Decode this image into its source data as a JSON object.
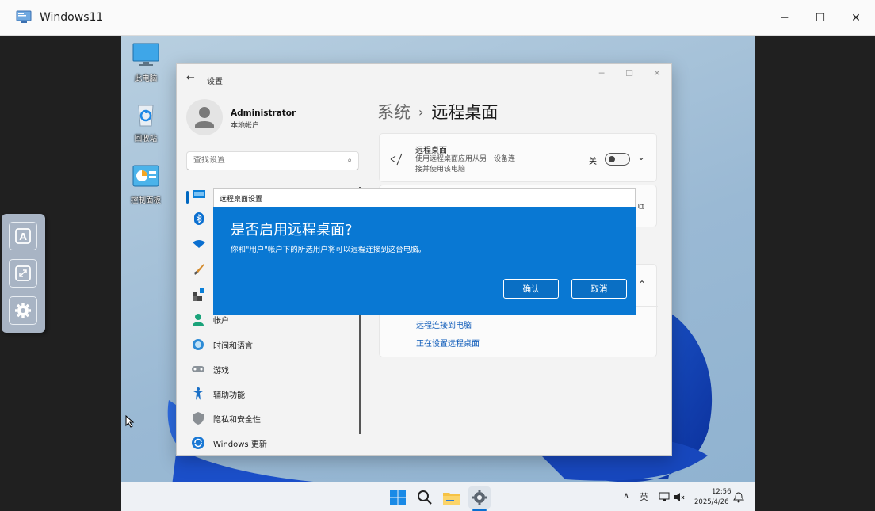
{
  "host": {
    "title": "Windows11",
    "controls": {
      "minimize": "─",
      "maximize": "☐",
      "close": "✕"
    }
  },
  "desktop": {
    "icons": [
      {
        "label": "此电脑"
      },
      {
        "label": "回收站"
      },
      {
        "label": "控制面板"
      }
    ]
  },
  "settings": {
    "window_title": "设置",
    "back_glyph": "←",
    "controls": {
      "minimize": "─",
      "maximize": "☐",
      "close": "✕"
    },
    "user": {
      "name": "Administrator",
      "type": "本地帐户"
    },
    "search": {
      "placeholder": "查找设置"
    },
    "nav": [
      {
        "label": "帐户",
        "icon": "account-icon"
      },
      {
        "label": "时间和语言",
        "icon": "time-language-icon"
      },
      {
        "label": "游戏",
        "icon": "gaming-icon"
      },
      {
        "label": "辅助功能",
        "icon": "accessibility-icon"
      },
      {
        "label": "隐私和安全性",
        "icon": "privacy-shield-icon"
      },
      {
        "label": "Windows 更新",
        "icon": "windows-update-icon"
      }
    ],
    "breadcrumb": {
      "parent": "系统",
      "separator": "›",
      "current": "远程桌面"
    },
    "rdp_card": {
      "title": "远程桌面",
      "desc_line1": "使用远程桌面应用从另一设备连",
      "desc_line2": "接并使用该电脑",
      "toggle_state": "关",
      "toggle_on": false
    },
    "help_links": [
      "远程连接到电脑",
      "正在设置远程桌面"
    ]
  },
  "dialog": {
    "window_title": "远程桌面设置",
    "heading": "是否启用远程桌面?",
    "message": "你和\"用户\"帐户下的所选用户将可以远程连接到这台电脑。",
    "confirm_label": "确认",
    "cancel_label": "取消"
  },
  "taskbar": {
    "tray": {
      "chevron": "∧",
      "ime": "英"
    },
    "time": "12:56",
    "date": "2025/4/26"
  },
  "colors": {
    "accent": "#0067c0",
    "dialog_blue": "#0978d3",
    "link": "#0a58b8"
  }
}
